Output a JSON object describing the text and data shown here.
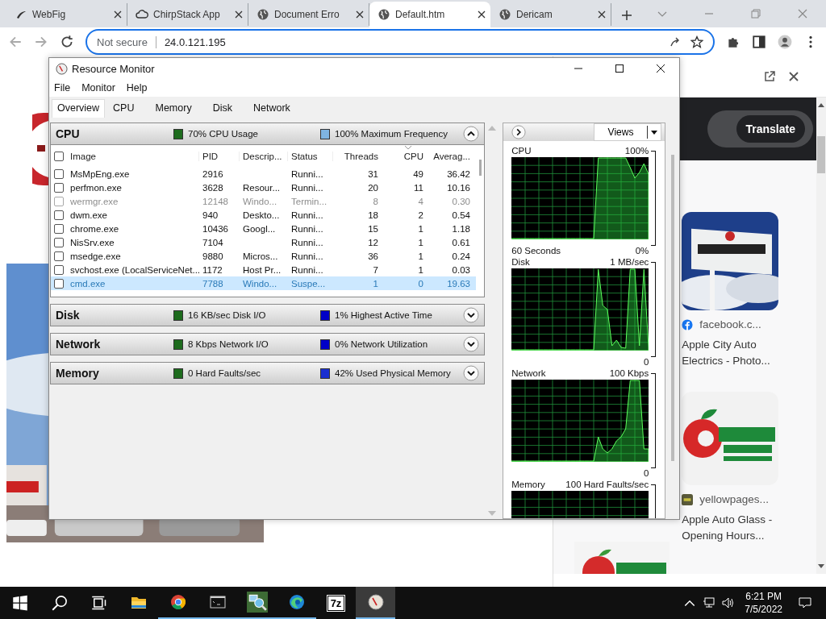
{
  "browser": {
    "tabs": [
      {
        "label": "WebFig",
        "selected": false
      },
      {
        "label": "ChirpStack App",
        "selected": false
      },
      {
        "label": "Document Erro",
        "selected": false
      },
      {
        "label": "Default.htm",
        "selected": true
      },
      {
        "label": "Dericam",
        "selected": false
      }
    ],
    "address": {
      "security": "Not secure",
      "url": "24.0.121.195"
    },
    "side_panel": {
      "button": "Translate",
      "cards": [
        {
          "source": "facebook.c...",
          "title": "Apple City Auto Electrics - Photo..."
        },
        {
          "source": "yellowpages...",
          "title": "Apple Auto Glass - Opening Hours..."
        }
      ]
    }
  },
  "resource_monitor": {
    "title": "Resource Monitor",
    "menu": [
      "File",
      "Monitor",
      "Help"
    ],
    "tabs": [
      {
        "label": "Overview",
        "selected": true
      },
      {
        "label": "CPU",
        "selected": false
      },
      {
        "label": "Memory",
        "selected": false
      },
      {
        "label": "Disk",
        "selected": false
      },
      {
        "label": "Network",
        "selected": false
      }
    ],
    "sections": [
      {
        "title": "CPU",
        "expanded": true,
        "stats": [
          {
            "text": "70% CPU Usage",
            "color": "#1d6b1d"
          },
          {
            "text": "100% Maximum Frequency",
            "color": "#7fb4e0"
          }
        ],
        "table": {
          "select_all_checked": false,
          "columns": [
            {
              "label": "Image",
              "sorted": false
            },
            {
              "label": "PID",
              "sorted": false
            },
            {
              "label": "Descrip...",
              "sorted": false
            },
            {
              "label": "Status",
              "sorted": false
            },
            {
              "label": "Threads",
              "sorted": false
            },
            {
              "label": "CPU",
              "sorted": true
            },
            {
              "label": "Averag...",
              "sorted": false
            }
          ],
          "rows": [
            {
              "image": "MsMpEng.exe",
              "pid": "2916",
              "status": "Runni...",
              "threads": "31",
              "cpu": "49",
              "average": "36.42",
              "disabled": false,
              "suspended": false,
              "checked": false,
              "selected": false
            },
            {
              "image": "perfmon.exe",
              "pid": "3628",
              "description": "Resour...",
              "status": "Runni...",
              "threads": "20",
              "cpu": "11",
              "average": "10.16",
              "disabled": false,
              "suspended": false,
              "checked": false,
              "selected": false
            },
            {
              "image": "wermgr.exe",
              "pid": "12148",
              "description": "Windo...",
              "status": "Termin...",
              "threads": "8",
              "cpu": "4",
              "average": "0.30",
              "disabled": true,
              "suspended": false,
              "checked": false,
              "selected": false
            },
            {
              "image": "dwm.exe",
              "pid": "940",
              "description": "Deskto...",
              "status": "Runni...",
              "threads": "18",
              "cpu": "2",
              "average": "0.54",
              "disabled": false,
              "suspended": false,
              "checked": false,
              "selected": false
            },
            {
              "image": "chrome.exe",
              "pid": "10436",
              "description": "Googl...",
              "status": "Runni...",
              "threads": "15",
              "cpu": "1",
              "average": "1.18",
              "disabled": false,
              "suspended": false,
              "checked": false,
              "selected": false
            },
            {
              "image": "NisSrv.exe",
              "pid": "7104",
              "status": "Runni...",
              "threads": "12",
              "cpu": "1",
              "average": "0.61",
              "disabled": false,
              "suspended": false,
              "checked": false,
              "selected": false
            },
            {
              "image": "msedge.exe",
              "pid": "9880",
              "description": "Micros...",
              "status": "Runni...",
              "threads": "36",
              "cpu": "1",
              "average": "0.24",
              "disabled": false,
              "suspended": false,
              "checked": false,
              "selected": false
            },
            {
              "image": "svchost.exe (LocalServiceNet...",
              "pid": "1172",
              "description": "Host Pr...",
              "status": "Runni...",
              "threads": "7",
              "cpu": "1",
              "average": "0.03",
              "disabled": false,
              "suspended": false,
              "checked": false,
              "selected": false
            },
            {
              "image": "cmd.exe",
              "pid": "7788",
              "description": "Windo...",
              "status": "Suspe...",
              "threads": "1",
              "cpu": "0",
              "average": "19.63",
              "disabled": false,
              "suspended": true,
              "checked": false,
              "selected": true
            }
          ]
        }
      },
      {
        "title": "Disk",
        "expanded": false,
        "stats": [
          {
            "text": "16 KB/sec Disk I/O",
            "color": "#1d6b1d"
          },
          {
            "text": "1% Highest Active Time",
            "color": "#0000c8"
          }
        ]
      },
      {
        "title": "Network",
        "expanded": false,
        "stats": [
          {
            "text": "8 Kbps Network I/O",
            "color": "#1d6b1d"
          },
          {
            "text": "0% Network Utilization",
            "color": "#0000c8"
          }
        ]
      },
      {
        "title": "Memory",
        "expanded": false,
        "stats": [
          {
            "text": "0 Hard Faults/sec",
            "color": "#1d6b1d"
          },
          {
            "text": "42% Used Physical Memory",
            "color": "#1a2fd0"
          }
        ]
      }
    ],
    "views_button": "Views",
    "graphs": [
      {
        "title": "CPU",
        "scale_max": "100%",
        "time_span": "60 Seconds",
        "scale_min": "0%"
      },
      {
        "title": "Disk",
        "scale_max": "1 MB/sec",
        "scale_min": "0"
      },
      {
        "title": "Network",
        "scale_max": "100 Kbps",
        "scale_min": "0"
      },
      {
        "title": "Memory",
        "scale_max": "100 Hard Faults/sec"
      }
    ]
  },
  "taskbar": {
    "items": [
      {
        "kind": "start",
        "running": false,
        "active": false
      },
      {
        "kind": "search",
        "running": false,
        "active": false
      },
      {
        "kind": "taskview",
        "running": false,
        "active": false
      },
      {
        "kind": "explorer",
        "running": false,
        "active": false
      },
      {
        "kind": "chrome",
        "running": true,
        "active": false
      },
      {
        "kind": "terminal",
        "running": true,
        "active": false
      },
      {
        "kind": "network-tool",
        "running": true,
        "active": false
      },
      {
        "kind": "edge",
        "running": true,
        "active": false
      },
      {
        "kind": "archiver",
        "label": "7z",
        "running": false,
        "active": false
      },
      {
        "kind": "gauge",
        "running": true,
        "active": true
      }
    ],
    "time": "6:21 PM",
    "date": "7/5/2022"
  }
}
